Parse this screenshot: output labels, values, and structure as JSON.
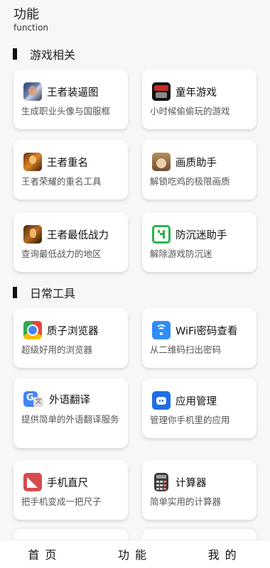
{
  "header": {
    "title": "功能",
    "subtitle": "function"
  },
  "sections": [
    {
      "label": "游戏相关",
      "cards": [
        {
          "name": "王者装逼图",
          "desc": "生成职业头像与国服框",
          "icon": "hero-avatar-icon"
        },
        {
          "name": "童年游戏",
          "desc": "小时候偷偷玩的游戏",
          "icon": "retro-game-icon"
        },
        {
          "name": "王者重名",
          "desc": "王者荣耀的重名工具",
          "icon": "hero-portrait-icon"
        },
        {
          "name": "画质助手",
          "desc": "解锁吃鸡的极限画质",
          "icon": "pubg-character-icon"
        },
        {
          "name": "王者最低战力",
          "desc": "查询最低战力的地区",
          "icon": "warrior-icon"
        },
        {
          "name": "防沉迷助手",
          "desc": "解除游戏防沉迷",
          "icon": "anti-addiction-icon"
        }
      ]
    },
    {
      "label": "日常工具",
      "cards": [
        {
          "name": "质子浏览器",
          "desc": "超级好用的浏览器",
          "icon": "browser-icon"
        },
        {
          "name": "WiFi密码查看",
          "desc": "从二维码扫出密码",
          "icon": "wifi-icon"
        },
        {
          "name": "外语翻译",
          "desc": "提供简单的外语翻译服务",
          "icon": "translate-icon"
        },
        {
          "name": "应用管理",
          "desc": "管理你手机里的应用",
          "icon": "app-manager-icon"
        },
        {
          "name": "手机直尺",
          "desc": "把手机变成一把尺子",
          "icon": "ruler-icon"
        },
        {
          "name": "计算器",
          "desc": "简单实用的计算器",
          "icon": "calculator-icon"
        }
      ]
    }
  ],
  "nav": {
    "home": "首页",
    "function": "功能",
    "mine": "我的"
  }
}
